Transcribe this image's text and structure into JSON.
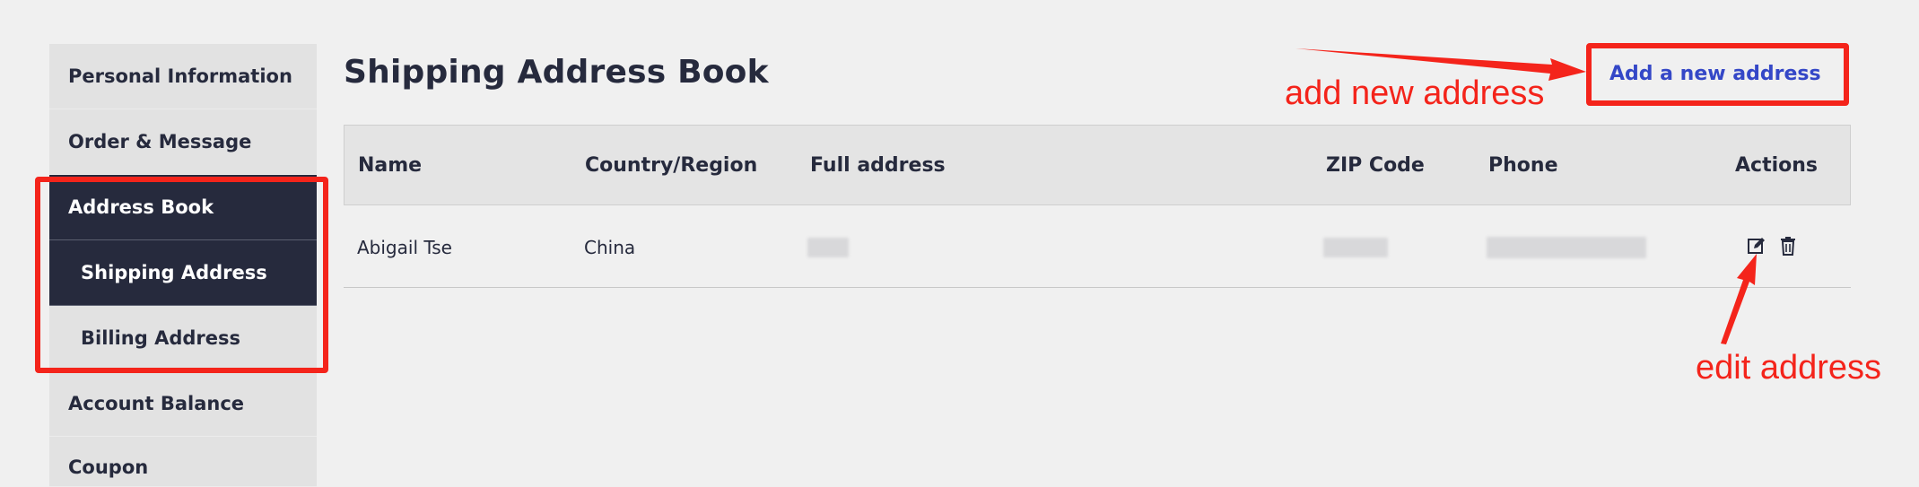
{
  "sidebar": {
    "items": [
      {
        "label": "Personal Information"
      },
      {
        "label": "Order & Message"
      },
      {
        "label": "Address Book"
      },
      {
        "label": "Shipping Address"
      },
      {
        "label": "Billing Address"
      },
      {
        "label": "Account Balance"
      },
      {
        "label": "Coupon"
      }
    ]
  },
  "main": {
    "title": "Shipping Address Book",
    "add_link": "Add a new address",
    "table": {
      "headers": [
        "Name",
        "Country/Region",
        "Full address",
        "ZIP Code",
        "Phone",
        "Actions"
      ],
      "rows": [
        {
          "name": "Abigail Tse",
          "country": "China"
        }
      ]
    }
  },
  "annotations": {
    "add_note": "add new address",
    "edit_note": "edit address"
  },
  "colors": {
    "accent": "#3447c7",
    "sidebar_active": "#262a3d",
    "annotation": "#f4241b"
  },
  "icons": {
    "edit": "edit-icon",
    "delete": "trash-icon"
  }
}
